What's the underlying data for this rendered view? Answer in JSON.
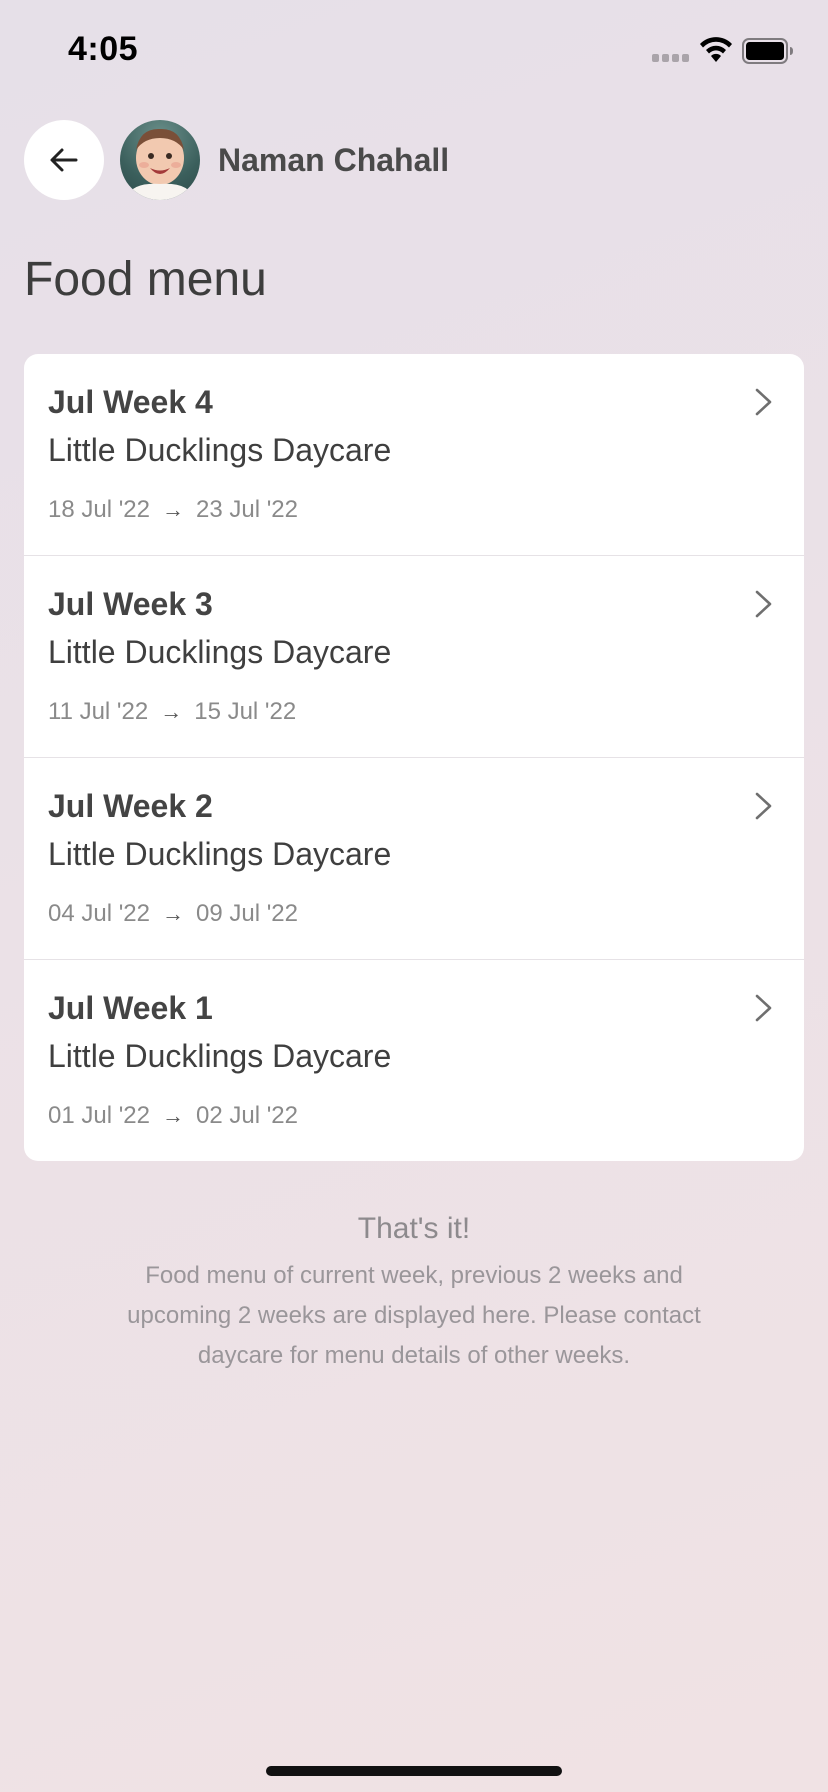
{
  "status_bar": {
    "time": "4:05",
    "icons": [
      "signal-icon",
      "wifi-icon",
      "battery-icon"
    ]
  },
  "header": {
    "back_icon": "arrow-left-icon",
    "child_name": "Naman Chahall"
  },
  "page_title": "Food menu",
  "menu_items": [
    {
      "title": "Jul Week 4",
      "daycare": "Little Ducklings Daycare",
      "start": "18 Jul '22",
      "arrow": "→",
      "end": "23 Jul '22"
    },
    {
      "title": "Jul Week 3",
      "daycare": "Little Ducklings Daycare",
      "start": "11 Jul '22",
      "arrow": "→",
      "end": "15 Jul '22"
    },
    {
      "title": "Jul Week 2",
      "daycare": "Little Ducklings Daycare",
      "start": "04 Jul '22",
      "arrow": "→",
      "end": "09 Jul '22"
    },
    {
      "title": "Jul Week 1",
      "daycare": "Little Ducklings Daycare",
      "start": "01 Jul '22",
      "arrow": "→",
      "end": "02 Jul '22"
    }
  ],
  "footer": {
    "title": "That's it!",
    "text": "Food menu of current week, previous 2 weeks and upcoming 2 weeks are displayed here. Please contact daycare for menu details of other weeks."
  }
}
